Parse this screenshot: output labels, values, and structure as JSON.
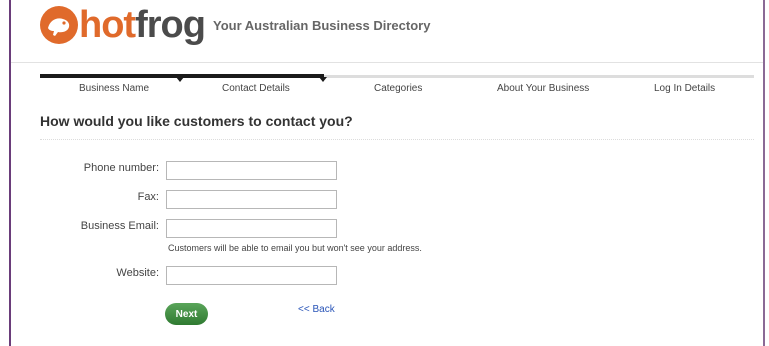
{
  "header": {
    "logo_hot": "hot",
    "logo_frog": "frog",
    "tagline": "Your Australian Business Directory"
  },
  "progress": {
    "steps": [
      {
        "label": "Business Name"
      },
      {
        "label": "Contact Details"
      },
      {
        "label": "Categories"
      },
      {
        "label": "About Your Business"
      },
      {
        "label": "Log In Details"
      }
    ],
    "completed_steps": 2
  },
  "form": {
    "title": "How would you like customers to contact you?",
    "phone": {
      "label": "Phone number:",
      "value": ""
    },
    "fax": {
      "label": "Fax:",
      "value": ""
    },
    "email": {
      "label": "Business Email:",
      "value": "",
      "helper": "Customers will be able to email you but won't see your address."
    },
    "website": {
      "label": "Website:",
      "value": ""
    }
  },
  "actions": {
    "next_label": "Next",
    "back_label": "<< Back"
  },
  "colors": {
    "brand_orange": "#e06a2b",
    "button_green": "#3d8c3f",
    "link_blue": "#2a55b8"
  }
}
